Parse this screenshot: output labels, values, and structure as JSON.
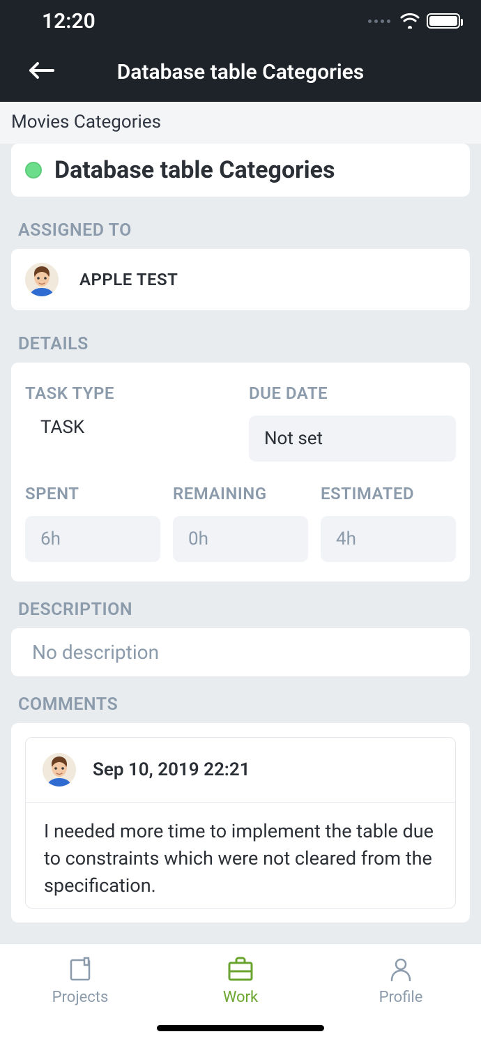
{
  "status_bar": {
    "time": "12:20"
  },
  "nav": {
    "title": "Database table Categories"
  },
  "breadcrumb": "Movies Categories",
  "task": {
    "title": "Database table Categories",
    "status_color": "#6cdd8a"
  },
  "sections": {
    "assigned_to": "ASSIGNED TO",
    "details": "DETAILS",
    "description": "DESCRIPTION",
    "comments": "COMMENTS"
  },
  "assignee": {
    "name": "APPLE TEST"
  },
  "details": {
    "labels": {
      "task_type": "TASK TYPE",
      "due_date": "DUE DATE",
      "spent": "SPENT",
      "remaining": "REMAINING",
      "estimated": "ESTIMATED"
    },
    "task_type": "TASK",
    "due_date": "Not set",
    "spent": "6h",
    "remaining": "0h",
    "estimated": "4h"
  },
  "description": {
    "text": "No description"
  },
  "comments": [
    {
      "date": "Sep 10, 2019 22:21",
      "body": "I needed more time to implement the table due to constraints which were not cleared from the specification."
    }
  ],
  "tabs": {
    "projects": "Projects",
    "work": "Work",
    "profile": "Profile"
  }
}
